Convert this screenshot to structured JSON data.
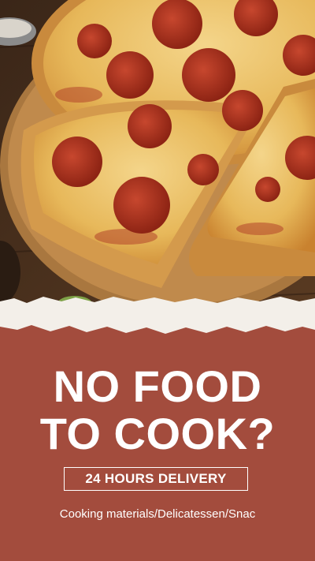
{
  "headline": {
    "line1": "NO FOOD",
    "line2": "TO COOK?"
  },
  "badge": {
    "label": "24 HOURS DELIVERY"
  },
  "categories": {
    "text": "Cooking materials/Delicatessen/Snac"
  },
  "colors": {
    "background": "#a34c3d",
    "text": "#ffffff",
    "paper": "#f3efe9"
  },
  "image": {
    "subject": "pepperoni-pizza-photo"
  }
}
